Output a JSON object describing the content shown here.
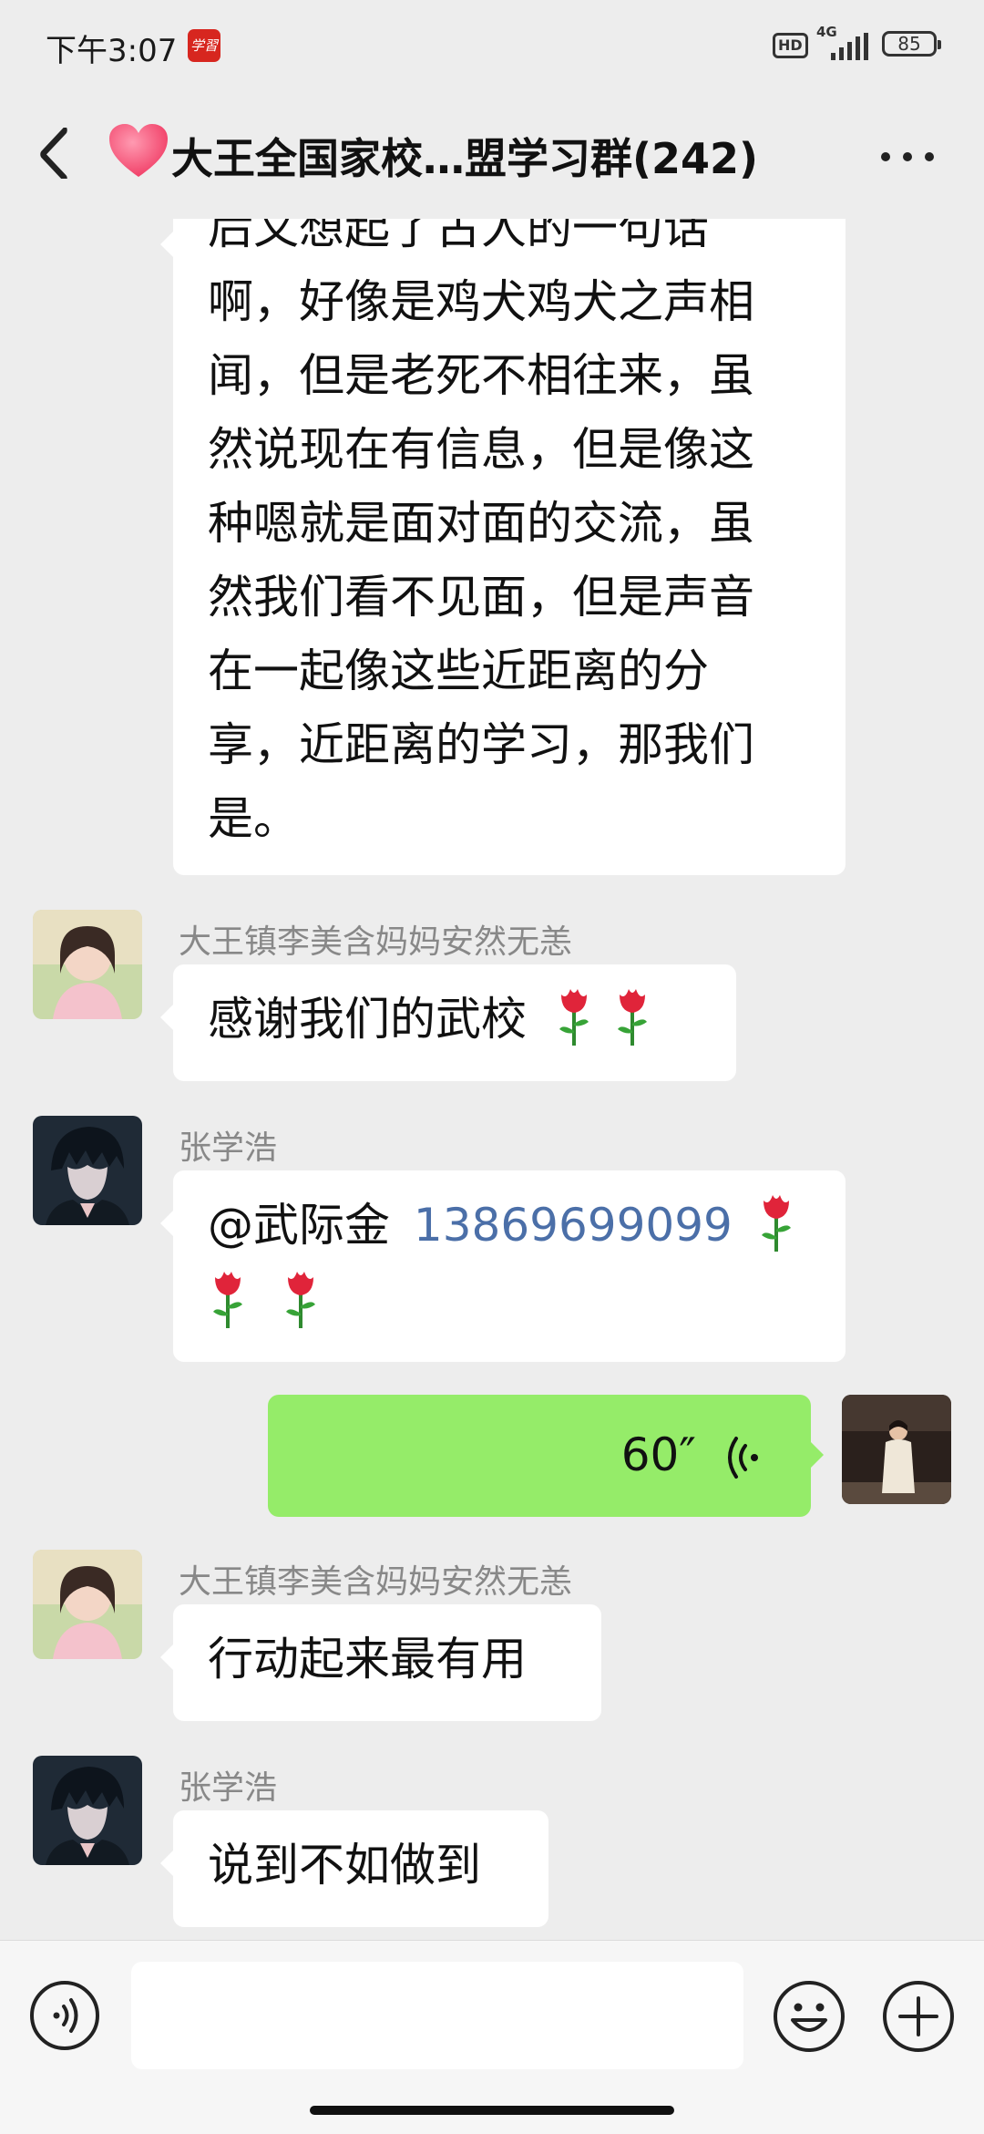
{
  "status_bar": {
    "time": "下午3:07",
    "app_badge": "学習",
    "hd": "HD",
    "network": "4G",
    "battery": "85"
  },
  "header": {
    "title": "大王全国家校…盟学习群(242)"
  },
  "messages": [
    {
      "type": "text",
      "side": "left",
      "lines": [
        "后又想起了古人的一句话",
        "啊，好像是鸡犬鸡犬之声相",
        "闻，但是老死不相往来，虽",
        "然说现在有信息，但是像这",
        "种嗯就是面对面的交流，虽",
        "然我们看不见面，但是声音",
        "在一起像这些近距离的分",
        "享，近距离的学习，那我们",
        "是。"
      ]
    },
    {
      "type": "text",
      "side": "left",
      "sender": "大王镇李美含妈妈安然无恙",
      "text": "感谢我们的武校",
      "roses": 2
    },
    {
      "type": "text",
      "side": "left",
      "sender": "张学浩",
      "mention": "@武际金",
      "phone": "13869699099",
      "roses": 3
    },
    {
      "type": "voice",
      "side": "right",
      "duration": "60″"
    },
    {
      "type": "text",
      "side": "left",
      "sender": "大王镇李美含妈妈安然无恙",
      "text": "行动起来最有用"
    },
    {
      "type": "text",
      "side": "left",
      "sender": "张学浩",
      "text": "说到不如做到"
    }
  ],
  "input": {
    "placeholder": ""
  },
  "colors": {
    "background": "#ededed",
    "bubble_self": "#95ec69",
    "bubble_other": "#ffffff",
    "link": "#4b6fa8"
  }
}
